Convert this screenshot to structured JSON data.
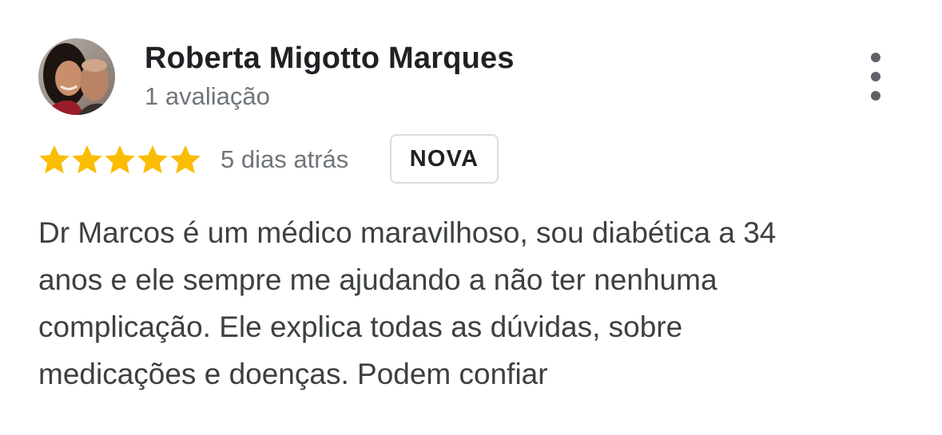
{
  "review": {
    "reviewer": {
      "name": "Roberta Migotto Marques",
      "review_count": "1 avaliação"
    },
    "rating": 5,
    "rating_max": 5,
    "star_color": "#fbbc04",
    "date": "5 dias atrás",
    "badge": "NOVA",
    "text_lines": [
      "Dr Marcos é um médico maravilhoso, sou diabética a 34",
      "anos e ele sempre me ajudando a não ter nenhuma",
      "complicação. Ele explica todas as dúvidas, sobre",
      "medicações e doenças. Podem confiar"
    ],
    "more_icon": "more-vert-icon"
  }
}
